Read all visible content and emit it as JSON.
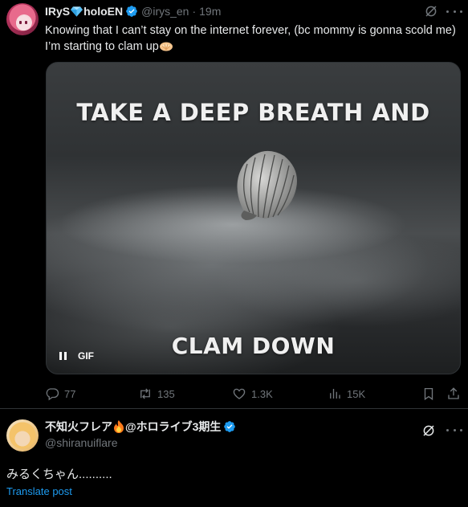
{
  "post1": {
    "display_name": "IRyS",
    "display_name_suffix": "holoEN",
    "handle": "@irys_en",
    "separator": "·",
    "time": "19m",
    "text": "Knowing that I can’t stay on the internet forever, (bc mommy is gonna scold me) I’m starting to clam up",
    "media": {
      "caption_top": "TAKE A DEEP BREATH AND",
      "caption_bottom": "CLAM DOWN",
      "gif_label": "GIF"
    },
    "actions": {
      "replies": "77",
      "reposts": "135",
      "likes": "1.3K",
      "views": "15K"
    },
    "icons": [
      "avatar",
      "gem-icon",
      "verified-badge-icon",
      "grok-icon",
      "more-icon",
      "clam-emoji-icon",
      "pause-icon",
      "reply-icon",
      "repost-icon",
      "like-icon",
      "views-icon",
      "bookmark-icon",
      "share-icon"
    ]
  },
  "post2": {
    "display_name_prefix": "不知火フレア",
    "display_name_suffix": "@ホロライブ3期生",
    "handle": "@shiranuiflare",
    "text": "みるくちゃん..........",
    "translate_label": "Translate post",
    "icons": [
      "avatar",
      "fire-emoji-icon",
      "verified-badge-icon",
      "grok-icon",
      "more-icon"
    ]
  },
  "colors": {
    "background": "#000000",
    "text_primary": "#e7e9ea",
    "text_secondary": "#71767b",
    "accent_blue": "#1d9bf0",
    "border": "#2f3336"
  }
}
